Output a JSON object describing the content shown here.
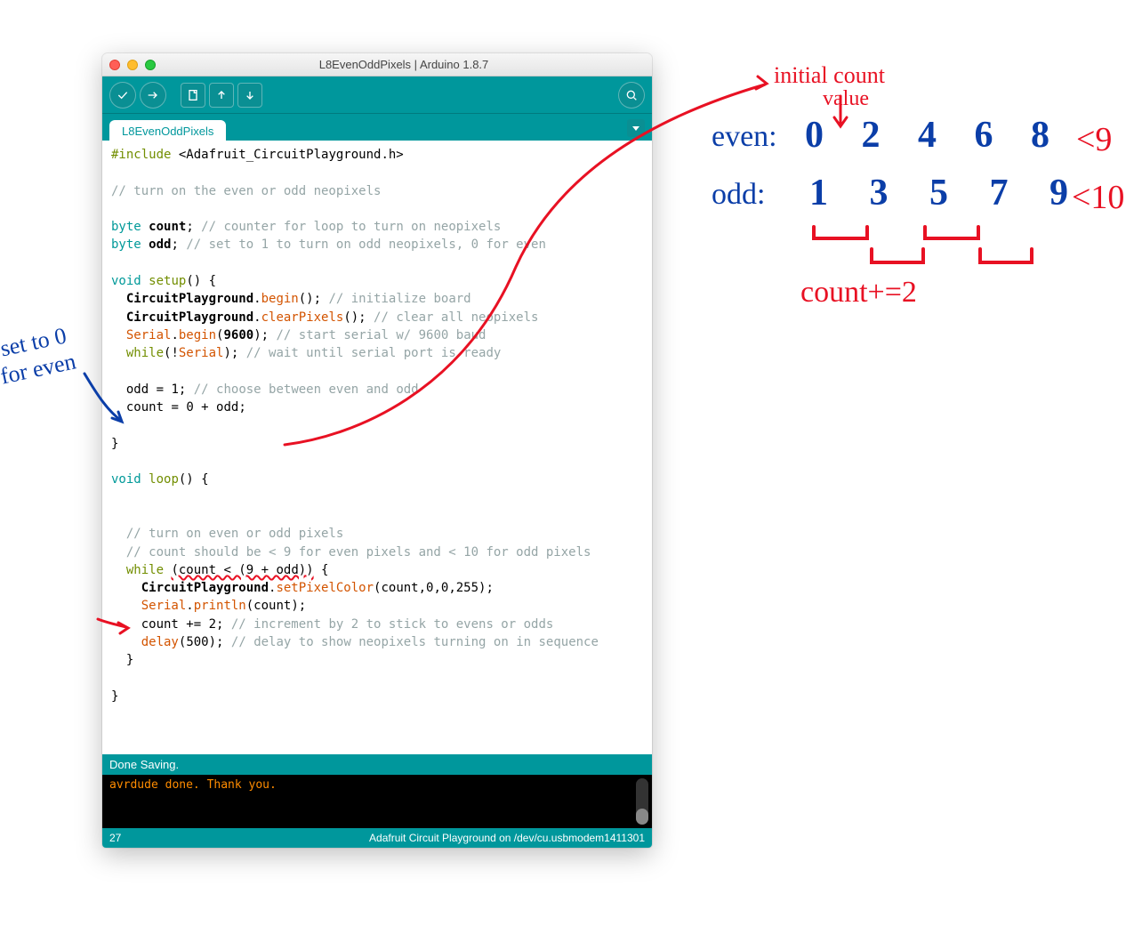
{
  "window": {
    "title": "L8EvenOddPixels | Arduino 1.8.7",
    "tab_label": "L8EvenOddPixels"
  },
  "toolbar": {
    "verify": "verify-button",
    "upload": "upload-button",
    "new": "new-button",
    "open": "open-button",
    "save": "save-button",
    "serial": "serial-monitor-button"
  },
  "code": {
    "l1_include": "#include",
    "l1_lib": "<Adafruit_CircuitPlayground.h>",
    "l3_comment": "// turn on the even or odd neopixels",
    "l5_type": "byte",
    "l5_ident": "count",
    "l5_comment": "// counter for loop to turn on neopixels",
    "l6_type": "byte",
    "l6_ident": "odd",
    "l6_comment": "// set to 1 to turn on odd neopixels, 0 for even",
    "l8_void": "void",
    "l8_setup": "setup",
    "l9_obj": "CircuitPlayground",
    "l9_fn": "begin",
    "l9_comment": "// initialize board",
    "l10_obj": "CircuitPlayground",
    "l10_fn": "clearPixels",
    "l10_comment": "// clear all neopixels",
    "l11_obj": "Serial",
    "l11_fn": "begin",
    "l11_arg": "9600",
    "l11_comment": "// start serial w/ 9600 baud",
    "l12_while": "while",
    "l12_obj": "Serial",
    "l12_comment": "// wait until serial port is ready",
    "l14_lhs": "odd",
    "l14_rhs": "1",
    "l14_comment": "// choose between even and odd",
    "l15_lhs": "count",
    "l15_rhs": "0 + odd",
    "l19_void": "void",
    "l19_loop": "loop",
    "l22_comment": "// turn on even or odd pixels",
    "l23_comment": "// count should be < 9 for even pixels and < 10 for odd pixels",
    "l24_while": "while",
    "l24_cond": "(count < (9 + odd))",
    "l25_obj": "CircuitPlayground",
    "l25_fn": "setPixelColor",
    "l25_args": "(count,0,0,255)",
    "l26_obj": "Serial",
    "l26_fn": "println",
    "l26_args": "(count)",
    "l27_stmt": "count += 2;",
    "l27_comment": "// increment by 2 to stick to evens or odds",
    "l28_fn": "delay",
    "l28_arg": "500",
    "l28_comment": "// delay to show neopixels turning on in sequence"
  },
  "status": {
    "text": "Done Saving."
  },
  "console": {
    "text": "avrdude done.  Thank you."
  },
  "footer": {
    "line": "27",
    "board": "Adafruit Circuit Playground on /dev/cu.usbmodem1411301"
  },
  "annotations": {
    "initial_count_label": "initial count",
    "value_label": "value",
    "even_label": "even:",
    "even_nums": "0 2 4 6 8",
    "even_lt": "<9",
    "odd_label": "odd:",
    "odd_nums": "1 3 5 7 9",
    "odd_lt": "<10",
    "count_plus": "count+=2",
    "set_to_0": "set to 0",
    "for_even": "for even"
  }
}
